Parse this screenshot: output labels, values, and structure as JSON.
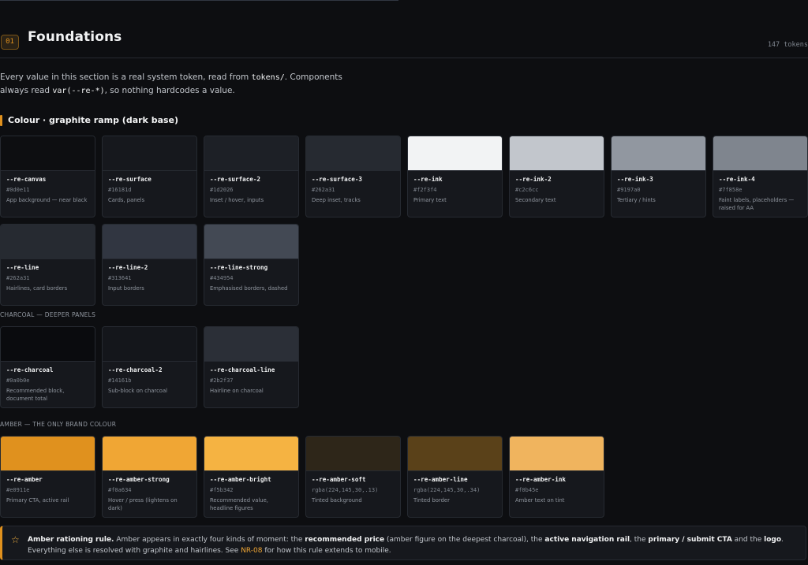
{
  "header": {
    "badge": "01",
    "title": "Foundations",
    "token_count": "147 tokens"
  },
  "intro": {
    "part1": "Every value in this section is a real system token, read from ",
    "code1": "tokens/",
    "part2": ". Components always read ",
    "code2": "var(--re-*)",
    "part3": ", so nothing hardcodes a value."
  },
  "section_title": "Colour · graphite ramp (dark base)",
  "graphite": [
    {
      "name": "--re-canvas",
      "hex": "#0d0e11",
      "desc": "App background — near black",
      "color": "#0d0e11"
    },
    {
      "name": "--re-surface",
      "hex": "#16181d",
      "desc": "Cards, panels",
      "color": "#16181d"
    },
    {
      "name": "--re-surface-2",
      "hex": "#1d2026",
      "desc": "Inset / hover, inputs",
      "color": "#1d2026"
    },
    {
      "name": "--re-surface-3",
      "hex": "#262a31",
      "desc": "Deep inset, tracks",
      "color": "#262a31"
    },
    {
      "name": "--re-ink",
      "hex": "#f2f3f4",
      "desc": "Primary text",
      "color": "#f2f3f4"
    },
    {
      "name": "--re-ink-2",
      "hex": "#c2c6cc",
      "desc": "Secondary text",
      "color": "#c2c6cc"
    },
    {
      "name": "--re-ink-3",
      "hex": "#9197a0",
      "desc": "Tertiary / hints",
      "color": "#9197a0"
    },
    {
      "name": "--re-ink-4",
      "hex": "#7f858e",
      "desc": "Faint labels, placeholders — raised for AA",
      "color": "#7f858e"
    },
    {
      "name": "--re-line",
      "hex": "#262a31",
      "desc": "Hairlines, card borders",
      "color": "#262a31"
    },
    {
      "name": "--re-line-2",
      "hex": "#313641",
      "desc": "Input borders",
      "color": "#313641"
    },
    {
      "name": "--re-line-strong",
      "hex": "#434954",
      "desc": "Emphasised borders, dashed",
      "color": "#434954"
    }
  ],
  "charcoal_label": "CHARCOAL — DEEPER PANELS",
  "charcoal": [
    {
      "name": "--re-charcoal",
      "hex": "#0a0b0e",
      "desc": "Recommended block, document total",
      "color": "#0a0b0e"
    },
    {
      "name": "--re-charcoal-2",
      "hex": "#14161b",
      "desc": "Sub-block on charcoal",
      "color": "#14161b"
    },
    {
      "name": "--re-charcoal-line",
      "hex": "#2b2f37",
      "desc": "Hairline on charcoal",
      "color": "#2b2f37"
    }
  ],
  "amber_label": "AMBER — THE ONLY BRAND COLOUR",
  "amber": [
    {
      "name": "--re-amber",
      "hex": "#e0911e",
      "desc": "Primary CTA, active rail",
      "color": "#e0911e"
    },
    {
      "name": "--re-amber-strong",
      "hex": "#f0a634",
      "desc": "Hover / press (lightens on dark)",
      "color": "#f0a634"
    },
    {
      "name": "--re-amber-bright",
      "hex": "#f5b342",
      "desc": "Recommended value, headline figures",
      "color": "#f5b342"
    },
    {
      "name": "--re-amber-soft",
      "hex": "rgba(224,145,30,.13)",
      "desc": "Tinted background",
      "color": "#2e2619"
    },
    {
      "name": "--re-amber-line",
      "hex": "rgba(224,145,30,.34)",
      "desc": "Tinted border",
      "color": "#5a4119"
    },
    {
      "name": "--re-amber-ink",
      "hex": "#f0b45e",
      "desc": "Amber text on tint",
      "color": "#f0b45e"
    }
  ],
  "callout": {
    "lead": "Amber rationing rule.",
    "t1": " Amber appears in exactly four kinds of moment: the ",
    "b1": "recommended price",
    "t2": " (amber figure on the deepest charcoal), the ",
    "b2": "active navigation rail",
    "t3": ", the ",
    "b3": "primary / submit CTA",
    "t4": " and the ",
    "b4": "logo",
    "t5": ". Everything else is resolved with graphite and hairlines. See ",
    "link": "NR-08",
    "t6": " for how this rule extends to mobile."
  }
}
